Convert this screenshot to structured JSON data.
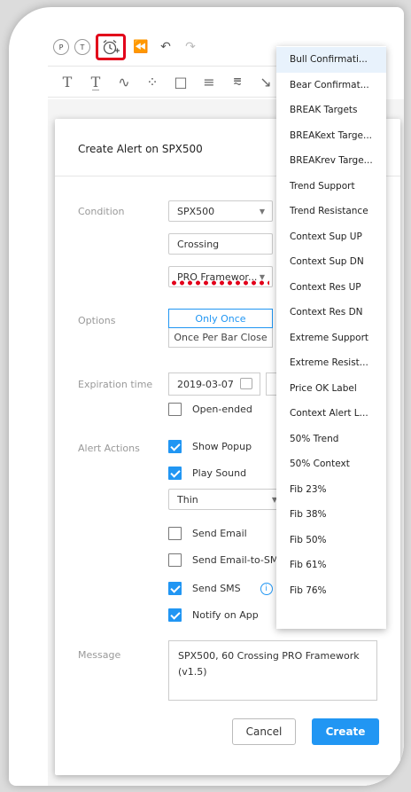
{
  "toolbar": {
    "btn_p": "P",
    "btn_t": "T"
  },
  "dialog": {
    "title": "Create Alert on SPX500",
    "condition_label": "Condition",
    "symbol_value": "SPX500",
    "crossing_value": "Crossing",
    "indicator_value": "PRO Framewor...",
    "options_label": "Options",
    "option_once": "Only Once",
    "option_bar_close": "Once Per Bar Close",
    "expiration_label": "Expiration time",
    "expiration_date": "2019-03-07",
    "open_ended_label": "Open-ended",
    "alert_actions_label": "Alert Actions",
    "show_popup_label": "Show Popup",
    "play_sound_label": "Play Sound",
    "sound_value": "Thin",
    "send_email_label": "Send Email",
    "send_email_sms_label": "Send Email-to-SMS",
    "send_sms_label": "Send SMS",
    "notify_app_label": "Notify on App",
    "message_label": "Message",
    "message_value": "SPX500, 60 Crossing PRO Framework (v1.5)",
    "cancel_label": "Cancel",
    "create_label": "Create",
    "checkbox_states": {
      "open_ended": false,
      "show_popup": true,
      "play_sound": true,
      "send_email": false,
      "send_email_sms": false,
      "send_sms": true,
      "notify_app": true
    }
  },
  "dropdown": {
    "items": [
      "Bull Confirmati...",
      "Bear Confirmat...",
      "BREAK Targets",
      "BREAKext Targe...",
      "BREAKrev Targe...",
      "Trend Support",
      "Trend Resistance",
      "Context Sup UP",
      "Context Sup DN",
      "Context Res UP",
      "Context Res DN",
      "Extreme Support",
      "Extreme Resist...",
      "Price OK Label",
      "Context Alert L...",
      "50% Trend",
      "50% Context",
      "Fib 23%",
      "Fib 38%",
      "Fib 50%",
      "Fib 61%",
      "Fib 76%"
    ],
    "selected_index": 0
  },
  "colors": {
    "accent": "#2196f3",
    "highlight_red": "#e2001a"
  }
}
